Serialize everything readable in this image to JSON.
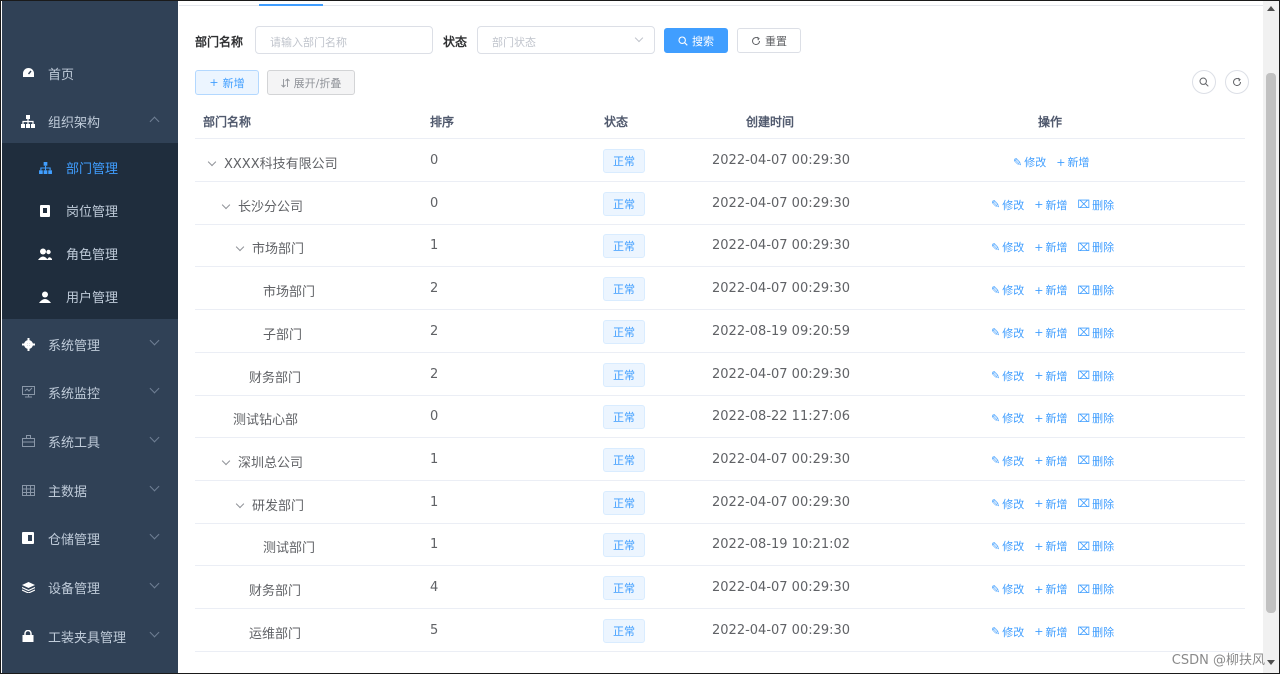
{
  "sidebar": {
    "items": [
      {
        "label": "首页",
        "icon": "dashboard-icon"
      },
      {
        "label": "组织架构",
        "icon": "tree-icon"
      },
      {
        "label": "系统管理",
        "icon": "gear-icon"
      },
      {
        "label": "系统监控",
        "icon": "monitor-icon"
      },
      {
        "label": "系统工具",
        "icon": "toolbox-icon"
      },
      {
        "label": "主数据",
        "icon": "table-icon"
      },
      {
        "label": "仓储管理",
        "icon": "warehouse-icon"
      },
      {
        "label": "设备管理",
        "icon": "layers-icon"
      },
      {
        "label": "工装夹具管理",
        "icon": "lock-icon"
      }
    ],
    "sub_items": [
      {
        "label": "部门管理",
        "icon": "tree-icon",
        "active": true
      },
      {
        "label": "岗位管理",
        "icon": "post-icon"
      },
      {
        "label": "角色管理",
        "icon": "peoples-icon"
      },
      {
        "label": "用户管理",
        "icon": "user-icon"
      }
    ]
  },
  "search": {
    "dept_label": "部门名称",
    "dept_placeholder": "请输入部门名称",
    "status_label": "状态",
    "status_placeholder": "部门状态",
    "search_btn": "搜索",
    "reset_btn": "重置"
  },
  "toolbar": {
    "add_btn": "新增",
    "expand_btn": "展开/折叠"
  },
  "table": {
    "headers": [
      "部门名称",
      "排序",
      "状态",
      "创建时间",
      "操作"
    ],
    "rows": [
      {
        "name": "XXXX科技有限公司",
        "level": 0,
        "expand": true,
        "order": "0",
        "status": "正常",
        "created": "2022-04-07 00:29:30",
        "ops": [
          "修改",
          "新增"
        ]
      },
      {
        "name": "长沙分公司",
        "level": 1,
        "expand": true,
        "order": "0",
        "status": "正常",
        "created": "2022-04-07 00:29:30",
        "ops": [
          "修改",
          "新增",
          "删除"
        ]
      },
      {
        "name": "市场部门",
        "level": 2,
        "expand": true,
        "order": "1",
        "status": "正常",
        "created": "2022-04-07 00:29:30",
        "ops": [
          "修改",
          "新增",
          "删除"
        ]
      },
      {
        "name": "市场部门",
        "level": 3,
        "expand": false,
        "order": "2",
        "status": "正常",
        "created": "2022-04-07 00:29:30",
        "ops": [
          "修改",
          "新增",
          "删除"
        ]
      },
      {
        "name": "子部门",
        "level": 3,
        "expand": false,
        "order": "2",
        "status": "正常",
        "created": "2022-08-19 09:20:59",
        "ops": [
          "修改",
          "新增",
          "删除"
        ]
      },
      {
        "name": "财务部门",
        "level": 2,
        "expand": false,
        "order": "2",
        "status": "正常",
        "created": "2022-04-07 00:29:30",
        "ops": [
          "修改",
          "新增",
          "删除"
        ]
      },
      {
        "name": "测试钻心部",
        "level": 1,
        "expand": false,
        "order": "0",
        "status": "正常",
        "created": "2022-08-22 11:27:06",
        "ops": [
          "修改",
          "新增",
          "删除"
        ]
      },
      {
        "name": "深圳总公司",
        "level": 1,
        "expand": true,
        "order": "1",
        "status": "正常",
        "created": "2022-04-07 00:29:30",
        "ops": [
          "修改",
          "新增",
          "删除"
        ]
      },
      {
        "name": "研发部门",
        "level": 2,
        "expand": true,
        "order": "1",
        "status": "正常",
        "created": "2022-04-07 00:29:30",
        "ops": [
          "修改",
          "新增",
          "删除"
        ]
      },
      {
        "name": "测试部门",
        "level": 3,
        "expand": false,
        "order": "1",
        "status": "正常",
        "created": "2022-08-19 10:21:02",
        "ops": [
          "修改",
          "新增",
          "删除"
        ]
      },
      {
        "name": "财务部门",
        "level": 2,
        "expand": false,
        "order": "4",
        "status": "正常",
        "created": "2022-04-07 00:29:30",
        "ops": [
          "修改",
          "新增",
          "删除"
        ]
      },
      {
        "name": "运维部门",
        "level": 2,
        "expand": false,
        "order": "5",
        "status": "正常",
        "created": "2022-04-07 00:29:30",
        "ops": [
          "修改",
          "新增",
          "删除"
        ]
      }
    ]
  },
  "watermark": "CSDN @柳扶风",
  "colors": {
    "sidebar": "#304156",
    "submenu": "#1f2d3d",
    "accent": "#409eff"
  }
}
